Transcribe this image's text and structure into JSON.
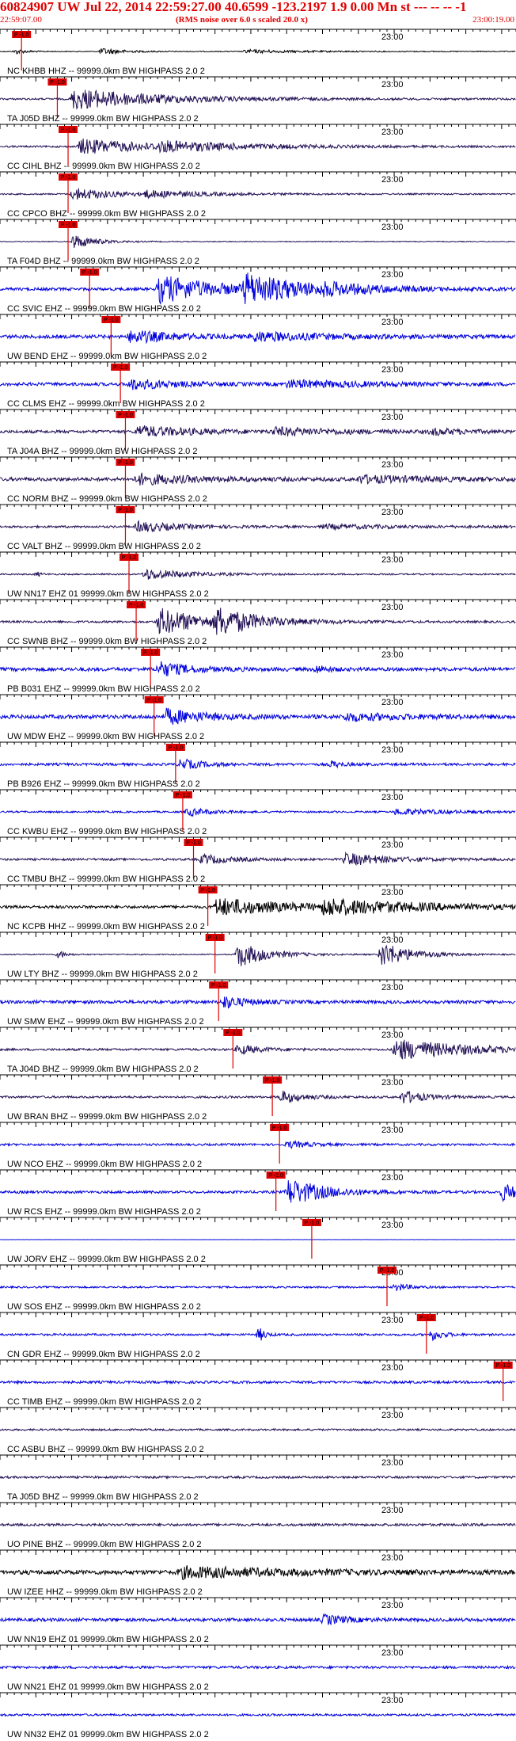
{
  "header": {
    "title": "60824907 UW Jul 22, 2014 22:59:27.00   40.6599 -123.2197  1.9 0.00 Mn st --- -- --  -1",
    "start_time": "22:59:07.00",
    "noise_note": "(RMS noise over 6.0 s scaled 20.0 x)",
    "end_time": "23:00:19.00"
  },
  "colors": {
    "header_red": "#e00000",
    "trace_black": "#000000",
    "trace_navy": "#221155",
    "trace_blue": "#0000dd",
    "pick_red": "#dd0000"
  },
  "chart_data": {
    "type": "line",
    "description_units": "time in seconds from 22:59:07.00",
    "xlim": [
      0,
      72
    ],
    "minute_mark": {
      "label": "23:00",
      "t": 53
    },
    "grid": false,
    "channels": [
      {
        "name": "NC KHBB HHZ -- 99999.0km BW  HIGHPASS  2.0  2",
        "color": "black",
        "pick": 3.0,
        "pick_label": "P -1.0",
        "events": [
          [
            14,
            1.0,
            3
          ],
          [
            2,
            0.8,
            1.5
          ],
          [
            34,
            0.5,
            8
          ]
        ],
        "noise": 0.12
      },
      {
        "name": "TA J05D BHZ -- 99999.0km BW  HIGHPASS  2.0  2",
        "color": "navy",
        "pick": 8.0,
        "pick_label": "P -1.0",
        "events": [
          [
            10,
            3.0,
            12
          ]
        ],
        "noise": 0.25
      },
      {
        "name": "CC CIHL BHZ -- 99999.0km BW  HIGHPASS  2.0  2",
        "color": "navy",
        "pick": 9.5,
        "pick_label": "P -1.0",
        "events": [
          [
            11,
            2.2,
            10
          ],
          [
            22,
            1.0,
            14
          ]
        ],
        "noise": 0.25
      },
      {
        "name": "CC CPCO BHZ -- 99999.0km BW  HIGHPASS  2.0  2",
        "color": "navy",
        "pick": 9.5,
        "pick_label": "P -1.0",
        "events": [
          [
            10,
            1.8,
            6
          ],
          [
            20,
            0.8,
            10
          ]
        ],
        "noise": 0.2
      },
      {
        "name": "TA F04D BHZ -- 99999.0km BW  HIGHPASS  2.0  2",
        "color": "navy",
        "pick": 9.5,
        "pick_label": "P -1.0",
        "events": [
          [
            10,
            2.2,
            3
          ]
        ],
        "noise": 0.12
      },
      {
        "name": "CC SVIC EHZ -- 99999.0km BW  HIGHPASS  2.0  2",
        "color": "blue",
        "pick": 12.5,
        "pick_label": "P -1.0",
        "events": [
          [
            22,
            4.0,
            8
          ],
          [
            34,
            4.0,
            8
          ],
          [
            45,
            1.0,
            8
          ]
        ],
        "noise": 0.4
      },
      {
        "name": "UW BEND EHZ -- 99999.0km BW  HIGHPASS  2.0  2",
        "color": "blue",
        "pick": 15.5,
        "pick_label": "P -1.0",
        "events": [
          [
            18,
            1.8,
            6
          ],
          [
            35,
            1.2,
            10
          ]
        ],
        "noise": 0.5
      },
      {
        "name": "CC CLMS EHZ -- 99999.0km BW  HIGHPASS  2.0  2",
        "color": "blue",
        "pick": 16.8,
        "pick_label": "P -1.0",
        "events": [
          [
            18,
            1.5,
            6
          ],
          [
            40,
            1.0,
            12
          ]
        ],
        "noise": 0.45
      },
      {
        "name": "TA J04A BHZ -- 99999.0km BW  HIGHPASS  2.0  2",
        "color": "navy",
        "pick": 17.5,
        "pick_label": "P -1.0",
        "events": [
          [
            19,
            1.6,
            8
          ],
          [
            38,
            1.0,
            10
          ],
          [
            60,
            0.8,
            5
          ]
        ],
        "noise": 0.4
      },
      {
        "name": "CC NORM BHZ -- 99999.0km BW  HIGHPASS  2.0  2",
        "color": "navy",
        "pick": 17.5,
        "pick_label": "P -1.0",
        "events": [
          [
            19,
            1.5,
            8
          ],
          [
            50,
            1.0,
            10
          ]
        ],
        "noise": 0.5
      },
      {
        "name": "CC VALT BHZ -- 99999.0km BW  HIGHPASS  2.0  2",
        "color": "navy",
        "pick": 17.5,
        "pick_label": "P -1.0",
        "events": [
          [
            19,
            1.5,
            6
          ],
          [
            45,
            0.6,
            10
          ]
        ],
        "noise": 0.3
      },
      {
        "name": "UW NN17 EHZ 01 99999.0km BW  HIGHPASS  2.0  2",
        "color": "navy",
        "pick": 18.0,
        "pick_label": "P -1.0",
        "events": [
          [
            20,
            1.6,
            6
          ],
          [
            5,
            0.9,
            0.6
          ]
        ],
        "noise": 0.2
      },
      {
        "name": "CC SWNB BHZ -- 99999.0km BW  HIGHPASS  2.0  2",
        "color": "navy",
        "pick": 19.0,
        "pick_label": "P -1.0",
        "events": [
          [
            22,
            4.0,
            6
          ],
          [
            30,
            3.5,
            6
          ]
        ],
        "noise": 0.3
      },
      {
        "name": "PB B031 EHZ -- 99999.0km BW  HIGHPASS  2.0  2",
        "color": "blue",
        "pick": 21.0,
        "pick_label": "P -1.0",
        "events": [
          [
            22,
            2.2,
            4
          ],
          [
            44,
            1.2,
            1.5
          ]
        ],
        "noise": 0.5
      },
      {
        "name": "UW MDW EHZ -- 99999.0km BW  HIGHPASS  2.0  2",
        "color": "blue",
        "pick": 21.5,
        "pick_label": "P -1.0",
        "events": [
          [
            23,
            2.2,
            5
          ],
          [
            48,
            1.0,
            8
          ]
        ],
        "noise": 0.55
      },
      {
        "name": "PB B926 EHZ -- 99999.0km BW  HIGHPASS  2.0  2",
        "color": "blue",
        "pick": 24.5,
        "pick_label": "P -1.0",
        "events": [
          [
            25,
            1.6,
            3
          ],
          [
            46,
            1.0,
            1.5
          ]
        ],
        "noise": 0.35
      },
      {
        "name": "CC KWBU EHZ -- 99999.0km BW  HIGHPASS  2.0  2",
        "color": "blue",
        "pick": 25.5,
        "pick_label": "P -1.0",
        "events": [
          [
            26,
            1.2,
            3
          ],
          [
            55,
            0.8,
            8
          ]
        ],
        "noise": 0.25
      },
      {
        "name": "CC TMBU BHZ -- 99999.0km BW  HIGHPASS  2.0  2",
        "color": "navy",
        "pick": 27.0,
        "pick_label": "P -1.0",
        "events": [
          [
            28,
            1.4,
            4
          ],
          [
            48,
            1.8,
            6
          ]
        ],
        "noise": 0.3
      },
      {
        "name": "NC KCPB HHZ -- 99999.0km BW  HIGHPASS  2.0  2",
        "color": "black",
        "pick": 29.0,
        "pick_label": "P -1.0",
        "events": [
          [
            30,
            2.5,
            10
          ],
          [
            45,
            2.0,
            14
          ]
        ],
        "noise": 0.4
      },
      {
        "name": "UW LTY BHZ -- 99999.0km BW  HIGHPASS  2.0  2",
        "color": "navy",
        "pick": 30.0,
        "pick_label": "P -1.0",
        "events": [
          [
            33,
            3.8,
            4
          ],
          [
            53,
            3.8,
            4
          ],
          [
            8,
            1.5,
            1
          ]
        ],
        "noise": 0.15
      },
      {
        "name": "UW SMW EHZ -- 99999.0km BW  HIGHPASS  2.0  2",
        "color": "blue",
        "pick": 30.5,
        "pick_label": "P -1.0",
        "events": [
          [
            31,
            1.8,
            3
          ]
        ],
        "noise": 0.45
      },
      {
        "name": "TA J04D BHZ -- 99999.0km BW  HIGHPASS  2.0  2",
        "color": "navy",
        "pick": 32.5,
        "pick_label": "P -1.0",
        "events": [
          [
            33,
            1.5,
            3
          ],
          [
            55,
            3.0,
            10
          ]
        ],
        "noise": 0.3
      },
      {
        "name": "UW BRAN BHZ -- 99999.0km BW  HIGHPASS  2.0  2",
        "color": "navy",
        "pick": 38.0,
        "pick_label": "P -1.0",
        "events": [
          [
            39,
            1.8,
            3
          ],
          [
            56,
            2.0,
            3
          ]
        ],
        "noise": 0.3
      },
      {
        "name": "UW NCO EHZ -- 99999.0km BW  HIGHPASS  2.0  2",
        "color": "blue",
        "pick": 39.0,
        "pick_label": "P -1.0",
        "events": [
          [
            40,
            1.0,
            3
          ]
        ],
        "noise": 0.3
      },
      {
        "name": "UW RCS EHZ -- 99999.0km BW  HIGHPASS  2.0  2",
        "color": "blue",
        "pick": 38.5,
        "pick_label": "P -1.0",
        "events": [
          [
            40,
            4.0,
            5
          ],
          [
            70,
            3.0,
            2
          ]
        ],
        "noise": 0.35
      },
      {
        "name": "UW JORV EHZ -- 99999.0km BW  HIGHPASS  2.0  2",
        "color": "blue",
        "pick": 43.5,
        "pick_label": "P -1.0",
        "events": [],
        "noise": 0.02
      },
      {
        "name": "UW SOS EHZ -- 99999.0km BW  HIGHPASS  2.0  2",
        "color": "blue",
        "pick": 54.0,
        "pick_label": "P -1.0",
        "events": [
          [
            55,
            1.2,
            2
          ]
        ],
        "noise": 0.25
      },
      {
        "name": "CN GDR EHZ -- 99999.0km BW  HIGHPASS  2.0  2",
        "color": "blue",
        "pick": 59.5,
        "pick_label": "P -1.0",
        "events": [
          [
            36,
            2.5,
            0.8
          ],
          [
            60,
            1.8,
            1.5
          ]
        ],
        "noise": 0.3
      },
      {
        "name": "CC TIMB EHZ -- 99999.0km BW  HIGHPASS  2.0  2",
        "color": "blue",
        "pick": 70.2,
        "pick_label": "P -1.0",
        "events": [],
        "noise": 0.35
      },
      {
        "name": "CC ASBU BHZ -- 99999.0km BW  HIGHPASS  2.0  2",
        "color": "navy",
        "pick": null,
        "pick_label": "",
        "events": [],
        "noise": 0.25
      },
      {
        "name": "TA J05D BHZ -- 99999.0km BW  HIGHPASS  2.0  2",
        "color": "navy",
        "pick": null,
        "pick_label": "",
        "events": [],
        "noise": 0.3
      },
      {
        "name": "UO PINE BHZ -- 99999.0km BW  HIGHPASS  2.0  2",
        "color": "navy",
        "pick": null,
        "pick_label": "",
        "events": [],
        "noise": 0.35
      },
      {
        "name": "UW IZEE HHZ -- 99999.0km BW  HIGHPASS  2.0  2",
        "color": "black",
        "pick": null,
        "pick_label": "",
        "events": [
          [
            25,
            1.5,
            15
          ]
        ],
        "noise": 0.6
      },
      {
        "name": "UW NN19 EHZ 01 99999.0km BW  HIGHPASS  2.0  2",
        "color": "blue",
        "pick": null,
        "pick_label": "",
        "events": [
          [
            45,
            1.5,
            3
          ]
        ],
        "noise": 0.45
      },
      {
        "name": "UW NN21 EHZ 01 99999.0km BW  HIGHPASS  2.0  2",
        "color": "blue",
        "pick": null,
        "pick_label": "",
        "events": [],
        "noise": 0.35
      },
      {
        "name": "UW NN32 EHZ 01 99999.0km BW  HIGHPASS  2.0  2",
        "color": "blue",
        "pick": null,
        "pick_label": "",
        "events": [],
        "noise": 0.3
      }
    ]
  }
}
